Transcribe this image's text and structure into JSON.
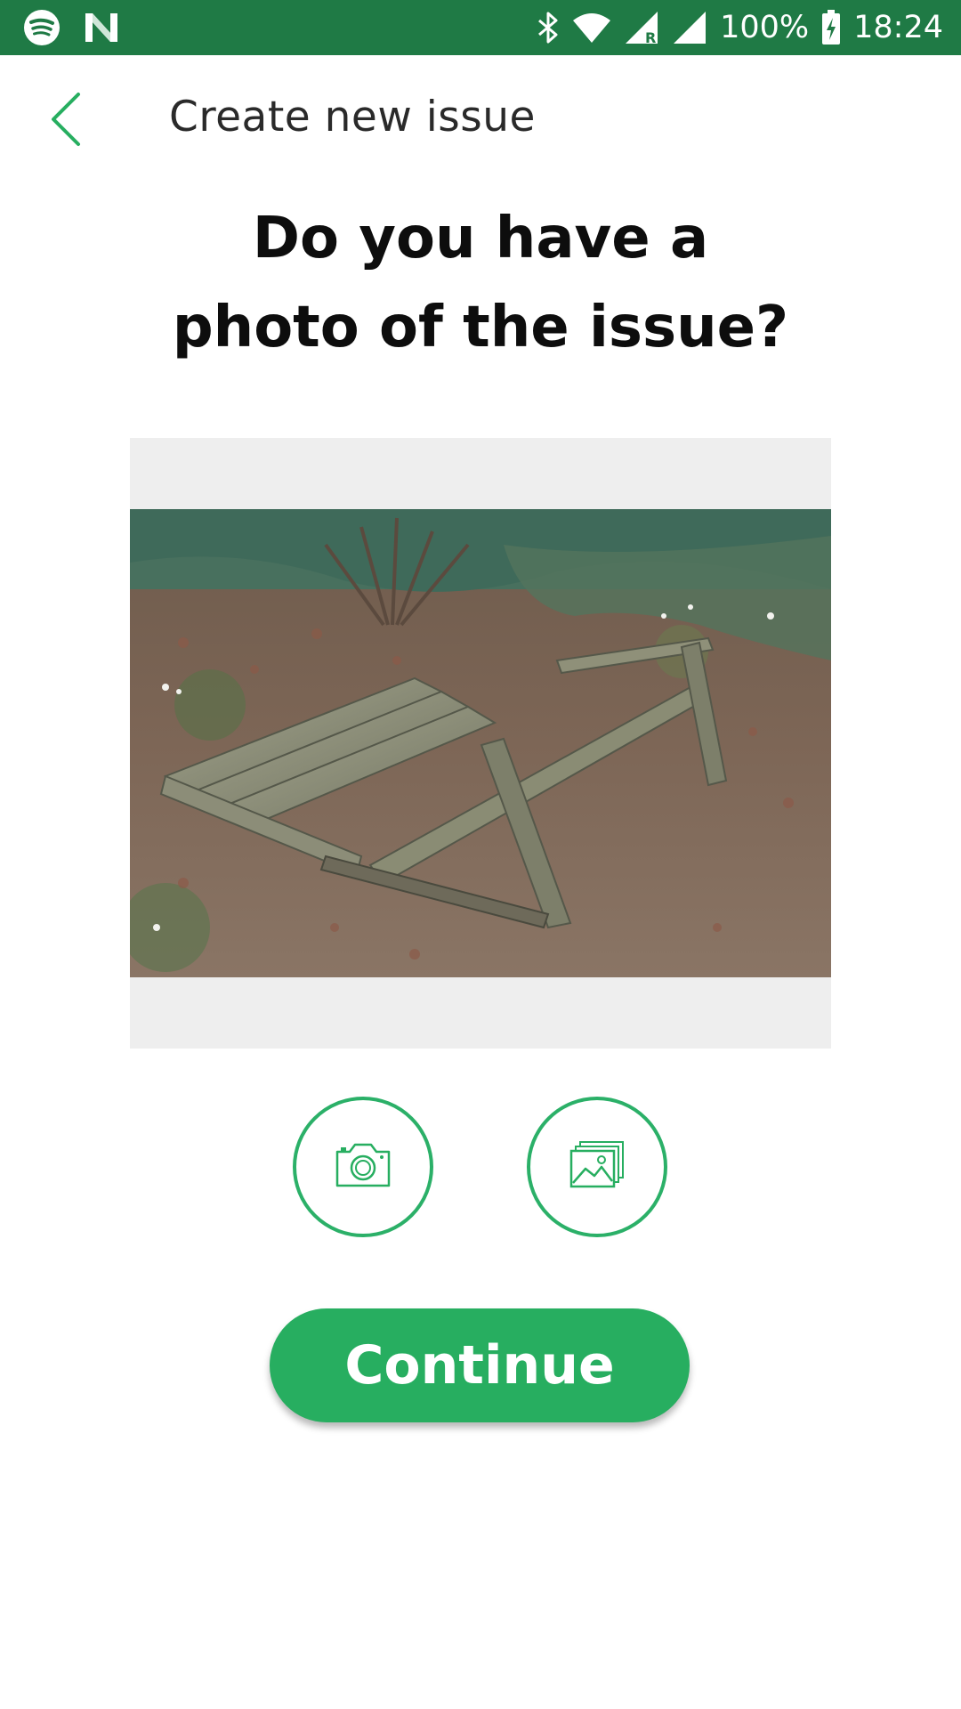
{
  "status_bar": {
    "icons_left": [
      "spotify-icon",
      "n-logo-icon"
    ],
    "icons_right": [
      "bluetooth-icon",
      "wifi-icon",
      "cell-signal-roaming-icon",
      "cell-signal-icon",
      "battery-charging-icon"
    ],
    "battery": "100%",
    "time": "18:24",
    "roaming_label": "R",
    "background_color": "#1f7a45"
  },
  "app_bar": {
    "back_icon": "chevron-left-icon",
    "title": "Create new issue"
  },
  "main": {
    "question_line1": "Do you have a",
    "question_line2": "photo of the issue?",
    "photo_description_alt": "Photo of a broken wooden bench",
    "camera_icon": "camera-icon",
    "gallery_icon": "gallery-icon",
    "continue_label": "Continue"
  },
  "colors": {
    "accent": "#27ae60",
    "accent_outline": "#2bb068",
    "status_bar": "#1f7a45"
  }
}
